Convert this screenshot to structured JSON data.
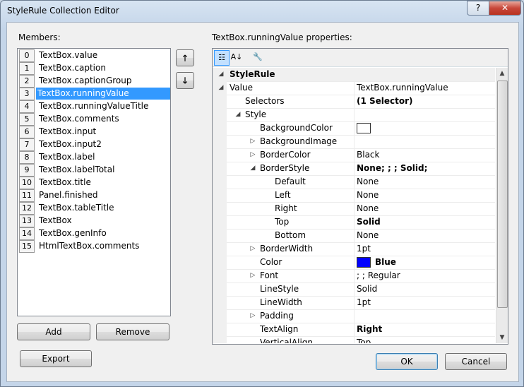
{
  "window": {
    "title": "StyleRule Collection Editor",
    "help_label": "?",
    "close_label": "✕"
  },
  "members": {
    "label": "Members:",
    "selected_index": 3,
    "items": [
      {
        "index": "0",
        "text": "TextBox.value"
      },
      {
        "index": "1",
        "text": "TextBox.caption"
      },
      {
        "index": "2",
        "text": "TextBox.captionGroup"
      },
      {
        "index": "3",
        "text": "TextBox.runningValue"
      },
      {
        "index": "4",
        "text": "TextBox.runningValueTitle"
      },
      {
        "index": "5",
        "text": "TextBox.comments"
      },
      {
        "index": "6",
        "text": "TextBox.input"
      },
      {
        "index": "7",
        "text": "TextBox.input2"
      },
      {
        "index": "8",
        "text": "TextBox.label"
      },
      {
        "index": "9",
        "text": "TextBox.labelTotal"
      },
      {
        "index": "10",
        "text": "TextBox.title"
      },
      {
        "index": "11",
        "text": "Panel.finished"
      },
      {
        "index": "12",
        "text": "TextBox.tableTitle"
      },
      {
        "index": "13",
        "text": "TextBox"
      },
      {
        "index": "14",
        "text": "TextBox.genInfo"
      },
      {
        "index": "15",
        "text": "HtmlTextBox.comments"
      }
    ],
    "up_icon": "arrow-up-icon",
    "down_icon": "arrow-down-icon",
    "add_label": "Add",
    "remove_label": "Remove"
  },
  "properties": {
    "label": "TextBox.runningValue properties:",
    "toolbar_icons": [
      "categorized-icon",
      "alphabetical-icon",
      "property-pages-icon"
    ],
    "rows": [
      {
        "name": "StyleRule",
        "value": "",
        "level": 0,
        "category": true,
        "expander": "expanded"
      },
      {
        "name": "Value",
        "value": "TextBox.runningValue",
        "level": 0,
        "expander": "expanded"
      },
      {
        "name": "Selectors",
        "value": "(1 Selector)",
        "level": 1,
        "bold": true
      },
      {
        "name": "Style",
        "value": "",
        "level": 1,
        "expander": "expanded"
      },
      {
        "name": "BackgroundColor",
        "value": "",
        "level": 2,
        "swatch": "#ffffff"
      },
      {
        "name": "BackgroundImage",
        "value": "",
        "level": 2,
        "expander": "collapsed"
      },
      {
        "name": "BorderColor",
        "value": "Black",
        "level": 2,
        "expander": "collapsed"
      },
      {
        "name": "BorderStyle",
        "value": "None; ; ; Solid;",
        "level": 2,
        "expander": "expanded",
        "bold": true,
        "highlight": true
      },
      {
        "name": "Default",
        "value": "None",
        "level": 3
      },
      {
        "name": "Left",
        "value": "None",
        "level": 3
      },
      {
        "name": "Right",
        "value": "None",
        "level": 3
      },
      {
        "name": "Top",
        "value": "Solid",
        "level": 3,
        "bold": true
      },
      {
        "name": "Bottom",
        "value": "None",
        "level": 3
      },
      {
        "name": "BorderWidth",
        "value": "1pt",
        "level": 2,
        "expander": "collapsed"
      },
      {
        "name": "Color",
        "value": "Blue",
        "level": 2,
        "swatch": "#0000ff",
        "bold": true
      },
      {
        "name": "Font",
        "value": "; ; Regular",
        "level": 2,
        "expander": "collapsed"
      },
      {
        "name": "LineStyle",
        "value": "Solid",
        "level": 2
      },
      {
        "name": "LineWidth",
        "value": "1pt",
        "level": 2
      },
      {
        "name": "Padding",
        "value": "",
        "level": 2,
        "expander": "collapsed"
      },
      {
        "name": "TextAlign",
        "value": "Right",
        "level": 2,
        "bold": true
      },
      {
        "name": "VerticalAlign",
        "value": "Top",
        "level": 2
      }
    ]
  },
  "footer": {
    "export_label": "Export",
    "ok_label": "OK",
    "cancel_label": "Cancel"
  }
}
